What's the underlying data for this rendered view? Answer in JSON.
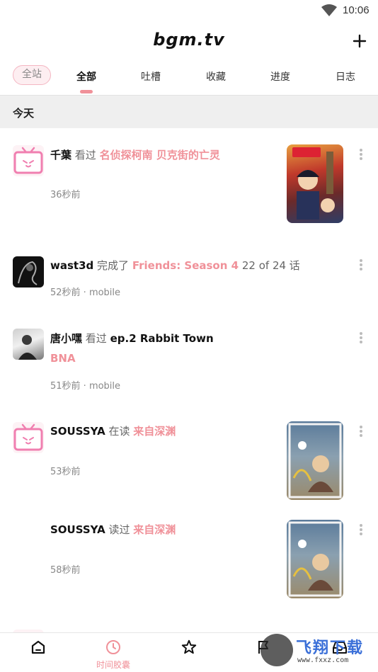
{
  "status_bar": {
    "time": "10:06",
    "icon": "wifi-icon"
  },
  "header": {
    "logo": "bgm.tv",
    "add_icon": "plus-icon"
  },
  "scope_chip": "全站",
  "tabs": [
    {
      "label": "全部",
      "active": true
    },
    {
      "label": "吐槽"
    },
    {
      "label": "收藏"
    },
    {
      "label": "进度"
    },
    {
      "label": "日志"
    }
  ],
  "section": {
    "title": "今天"
  },
  "timeline": [
    {
      "user": "千葉",
      "action": "看过",
      "subject": "名侦探柯南 贝克街的亡灵",
      "time": "36秒前",
      "avatar": "tv-avatar",
      "cover": "conan-cover"
    },
    {
      "user": "wast3d",
      "action": "完成了",
      "subject": "Friends: Season 4",
      "progress": "22 of 24 话",
      "time": "52秒前 · mobile",
      "avatar": "dark-avatar"
    },
    {
      "user": "唐小嘿",
      "action": "看过",
      "episode": "ep.2 Rabbit Town",
      "subject": "BNA",
      "time": "51秒前 · mobile",
      "avatar": "photo-avatar"
    },
    {
      "user": "SOUSSYA",
      "action": "在读",
      "subject": "来自深渊",
      "time": "53秒前",
      "avatar": "tv-avatar",
      "cover": "abyss-cover"
    },
    {
      "user": "SOUSSYA",
      "action": "读过",
      "subject": "来自深渊",
      "time": "58秒前",
      "cover": "abyss-cover"
    }
  ],
  "bottom_nav": [
    {
      "icon": "home-icon"
    },
    {
      "icon": "clock-icon",
      "label": "时间胶囊",
      "active": true
    },
    {
      "icon": "star-icon"
    },
    {
      "icon": "flag-icon"
    },
    {
      "icon": "tray-icon"
    }
  ],
  "watermark": {
    "text": "飞翔下载",
    "url": "www.fxxz.com"
  },
  "colors": {
    "accent": "#f09199",
    "chip_bg": "#fdeef1",
    "section_bg": "#efefef",
    "subject": "#f09199"
  }
}
